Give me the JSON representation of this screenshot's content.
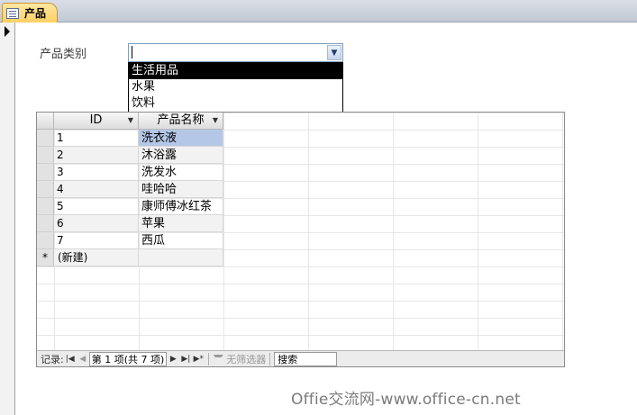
{
  "tab": {
    "title": "产品",
    "icon": "form-icon"
  },
  "form": {
    "category_label": "产品类别",
    "category_value": "",
    "dropdown_options": [
      "生活用品",
      "水果",
      "饮料"
    ],
    "dropdown_selected_index": 0
  },
  "datasheet": {
    "columns": [
      "ID",
      "产品名称"
    ],
    "rows": [
      {
        "id": "1",
        "name": "洗衣液"
      },
      {
        "id": "2",
        "name": "沐浴露"
      },
      {
        "id": "3",
        "name": "洗发水"
      },
      {
        "id": "4",
        "name": "哇哈哈"
      },
      {
        "id": "5",
        "name": "康师傅冰红茶"
      },
      {
        "id": "6",
        "name": "苹果"
      },
      {
        "id": "7",
        "name": "西瓜"
      }
    ],
    "new_row_marker": "*",
    "new_row_label": "(新建)"
  },
  "navigation": {
    "record_label": "记录:",
    "position_text": "第 1 项(共 7 项)",
    "filter_label": "无筛选器",
    "search_label": "搜索"
  },
  "watermark": "Offie交流网-www.office-cn.net",
  "colors": {
    "tab_accent": "#ffd064",
    "selection": "#b4c7e7",
    "dropdown_highlight": "#000000"
  }
}
